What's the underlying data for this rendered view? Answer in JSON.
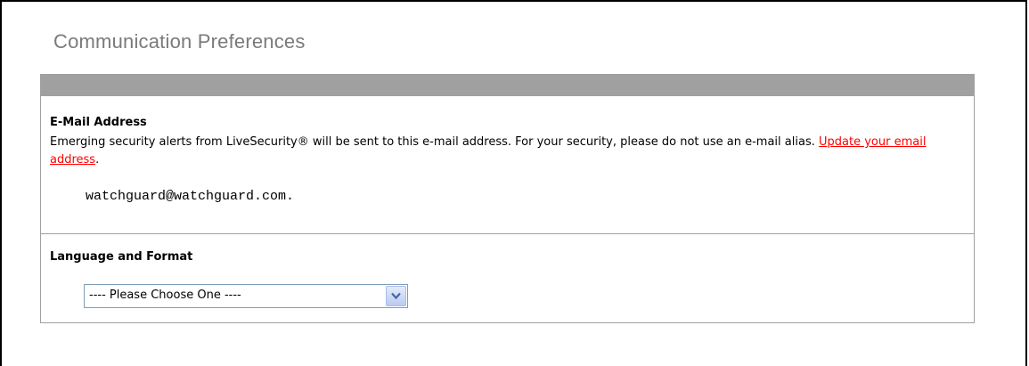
{
  "page": {
    "title": "Communication Preferences"
  },
  "email_section": {
    "heading": "E-Mail Address",
    "description": "Emerging security alerts from LiveSecurity® will be sent to this e-mail address. For your security, please do not use an e-mail alias.",
    "update_link": "Update your email address",
    "after_link": ".",
    "email": "watchguard@watchguard.com."
  },
  "language_section": {
    "heading": "Language and Format",
    "select_value": "---- Please Choose One ----",
    "arrow_icon": "chevron-down-icon"
  },
  "colors": {
    "title": "#7a7a7a",
    "header_bar": "#a0a0a0",
    "link": "#ff0000",
    "select_border": "#7f9db9"
  }
}
